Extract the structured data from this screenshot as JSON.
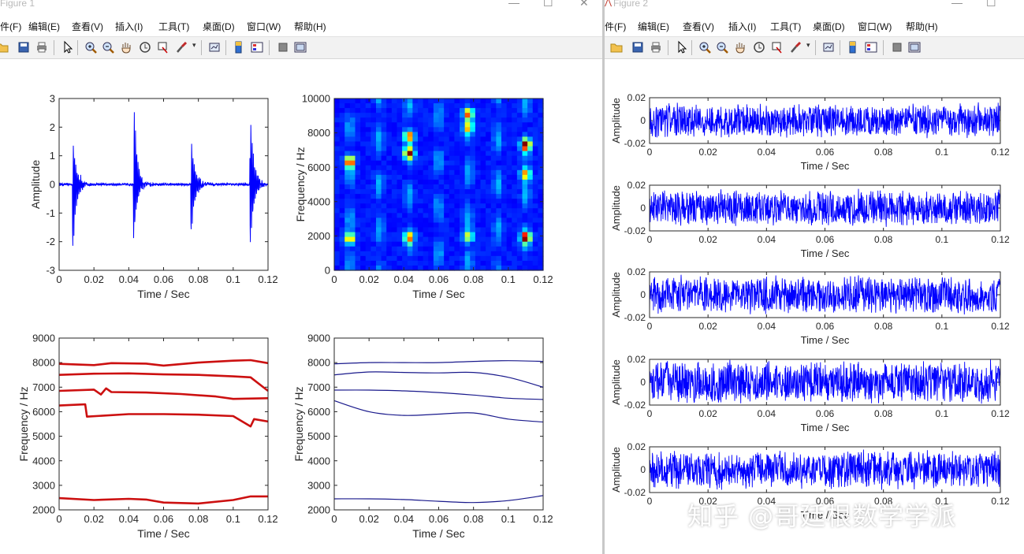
{
  "figure1": {
    "title": "Figure 1",
    "menu": [
      "件(F)",
      "编辑(E)",
      "查看(V)",
      "插入(I)",
      "工具(T)",
      "桌面(D)",
      "窗口(W)",
      "帮助(H)"
    ],
    "toolbar_icons": [
      "open-file-icon",
      "save-icon",
      "print-icon",
      "pointer-icon",
      "zoom-in-icon",
      "zoom-out-icon",
      "pan-hand-icon",
      "rotate-3d-icon",
      "data-cursor-icon",
      "brush-icon",
      "link-plot-icon",
      "colorbar-icon",
      "legend-icon",
      "hide-plot-tools-icon",
      "show-plot-tools-icon"
    ]
  },
  "figure2": {
    "title": "Figure 2",
    "menu": [
      "文件(F)",
      "编辑(E)",
      "查看(V)",
      "插入(I)",
      "工具(T)",
      "桌面(D)",
      "窗口(W)",
      "帮助(H)"
    ]
  },
  "colors": {
    "signal_blue": "#0000ff",
    "ridge_red": "#cc1010",
    "curve_navy": "#1a1a8c"
  },
  "chart_data": [
    {
      "type": "line",
      "xlabel": "Time / Sec",
      "ylabel": "Amplitude",
      "xlim": [
        0,
        0.12
      ],
      "ylim": [
        -3,
        3
      ],
      "xticks": [
        "0",
        "0.02",
        "0.04",
        "0.06",
        "0.08",
        "0.1",
        "0.12"
      ],
      "yticks": [
        "-3",
        "-2",
        "-1",
        "0",
        "1",
        "2",
        "3"
      ],
      "impulses": [
        {
          "t": 0.008,
          "peak": 1.65,
          "trough": -2.2
        },
        {
          "t": 0.043,
          "peak": 2.8,
          "trough": -1.85
        },
        {
          "t": 0.076,
          "peak": 1.65,
          "trough": -1.65
        },
        {
          "t": 0.11,
          "peak": 2.45,
          "trough": -2.05
        }
      ]
    },
    {
      "type": "heatmap",
      "xlabel": "Time / Sec",
      "ylabel": "Frequency / Hz",
      "xlim": [
        0,
        0.12
      ],
      "ylim": [
        0,
        10000
      ],
      "xticks": [
        "0",
        "0.02",
        "0.04",
        "0.06",
        "0.08",
        "0.1",
        "0.12"
      ],
      "yticks": [
        "0",
        "2000",
        "4000",
        "6000",
        "8000",
        "10000"
      ],
      "hotspots": [
        {
          "t": 0.009,
          "f": 6300,
          "level": 1.0
        },
        {
          "t": 0.009,
          "f": 1850,
          "level": 0.8
        },
        {
          "t": 0.043,
          "f": 7800,
          "level": 0.85
        },
        {
          "t": 0.043,
          "f": 6800,
          "level": 0.9
        },
        {
          "t": 0.043,
          "f": 1900,
          "level": 0.7
        },
        {
          "t": 0.077,
          "f": 9100,
          "level": 0.8
        },
        {
          "t": 0.077,
          "f": 8300,
          "level": 0.55
        },
        {
          "t": 0.077,
          "f": 1950,
          "level": 0.6
        },
        {
          "t": 0.11,
          "f": 7300,
          "level": 1.0
        },
        {
          "t": 0.11,
          "f": 5600,
          "level": 0.85
        },
        {
          "t": 0.11,
          "f": 1900,
          "level": 1.0
        }
      ]
    },
    {
      "type": "line",
      "xlabel": "Time / Sec",
      "ylabel": "Frequency / Hz",
      "xlim": [
        0,
        0.12
      ],
      "ylim": [
        2000,
        9000
      ],
      "xticks": [
        "0",
        "0.02",
        "0.04",
        "0.06",
        "0.08",
        "0.1",
        "0.12"
      ],
      "yticks": [
        "2000",
        "3000",
        "4000",
        "5000",
        "6000",
        "7000",
        "8000",
        "9000"
      ],
      "series": [
        {
          "x": [
            0,
            0.02,
            0.03,
            0.05,
            0.06,
            0.08,
            0.1,
            0.11,
            0.12
          ],
          "y": [
            7950,
            7900,
            7980,
            7960,
            7880,
            8000,
            8080,
            8100,
            7980
          ]
        },
        {
          "x": [
            0,
            0.02,
            0.04,
            0.06,
            0.08,
            0.1,
            0.11,
            0.12
          ],
          "y": [
            7500,
            7550,
            7560,
            7520,
            7500,
            7440,
            7400,
            6850
          ]
        },
        {
          "x": [
            0,
            0.02,
            0.024,
            0.027,
            0.03,
            0.05,
            0.07,
            0.09,
            0.1,
            0.12
          ],
          "y": [
            6850,
            6900,
            6700,
            6950,
            6800,
            6780,
            6720,
            6620,
            6520,
            6550
          ]
        },
        {
          "x": [
            0,
            0.015,
            0.016,
            0.04,
            0.06,
            0.08,
            0.1,
            0.11,
            0.112,
            0.12
          ],
          "y": [
            6250,
            6300,
            5800,
            5900,
            5900,
            5880,
            5820,
            5400,
            5700,
            5600
          ]
        },
        {
          "x": [
            0,
            0.02,
            0.04,
            0.05,
            0.06,
            0.08,
            0.1,
            0.11,
            0.12
          ],
          "y": [
            2480,
            2400,
            2450,
            2420,
            2300,
            2260,
            2400,
            2550,
            2550
          ]
        }
      ]
    },
    {
      "type": "line",
      "xlabel": "Time / Sec",
      "ylabel": "Frequency / Hz",
      "xlim": [
        0,
        0.12
      ],
      "ylim": [
        2000,
        9000
      ],
      "xticks": [
        "0",
        "0.02",
        "0.04",
        "0.06",
        "0.08",
        "0.1",
        "0.12"
      ],
      "yticks": [
        "2000",
        "3000",
        "4000",
        "5000",
        "6000",
        "7000",
        "8000",
        "9000"
      ],
      "series": [
        {
          "x": [
            0,
            0.02,
            0.04,
            0.06,
            0.08,
            0.1,
            0.12
          ],
          "y": [
            7950,
            8000,
            8000,
            8000,
            8050,
            8080,
            8050
          ]
        },
        {
          "x": [
            0,
            0.02,
            0.04,
            0.06,
            0.08,
            0.1,
            0.12
          ],
          "y": [
            7500,
            7620,
            7600,
            7580,
            7600,
            7400,
            7000
          ]
        },
        {
          "x": [
            0,
            0.02,
            0.04,
            0.06,
            0.08,
            0.1,
            0.12
          ],
          "y": [
            6880,
            6880,
            6850,
            6780,
            6680,
            6550,
            6500
          ]
        },
        {
          "x": [
            0,
            0.02,
            0.04,
            0.06,
            0.08,
            0.1,
            0.12
          ],
          "y": [
            6450,
            6000,
            5850,
            5900,
            5950,
            5700,
            5580
          ]
        },
        {
          "x": [
            0,
            0.02,
            0.04,
            0.06,
            0.08,
            0.1,
            0.12
          ],
          "y": [
            2450,
            2450,
            2420,
            2350,
            2300,
            2380,
            2580
          ]
        }
      ]
    },
    {
      "type": "line",
      "xlabel": "Time / Sec",
      "ylabel": "Amplitude",
      "xlim": [
        0,
        0.12
      ],
      "ylim": [
        -0.02,
        0.02
      ],
      "xticks": [
        "0",
        "0.02",
        "0.04",
        "0.06",
        "0.08",
        "0.1",
        "0.12"
      ],
      "yticks": [
        "0.02",
        "0",
        "-0.02"
      ],
      "noise_amplitude": 0.016
    },
    {
      "type": "line",
      "xlabel": "Time / Sec",
      "ylabel": "Amplitude",
      "xlim": [
        0,
        0.12
      ],
      "ylim": [
        -0.02,
        0.02
      ],
      "xticks": [
        "0",
        "0.02",
        "0.04",
        "0.06",
        "0.08",
        "0.1",
        "0.12"
      ],
      "yticks": [
        "0.02",
        "0",
        "-0.02"
      ],
      "noise_amplitude": 0.017
    },
    {
      "type": "line",
      "xlabel": "Time / Sec",
      "ylabel": "Amplitude",
      "xlim": [
        0,
        0.12
      ],
      "ylim": [
        -0.02,
        0.02
      ],
      "xticks": [
        "0",
        "0.02",
        "0.04",
        "0.06",
        "0.08",
        "0.1",
        "0.12"
      ],
      "yticks": [
        "0.02",
        "0",
        "-0.02"
      ],
      "noise_amplitude": 0.018
    },
    {
      "type": "line",
      "xlabel": "Time / Sec",
      "ylabel": "Amplitude",
      "xlim": [
        0,
        0.12
      ],
      "ylim": [
        -0.02,
        0.02
      ],
      "xticks": [
        "0",
        "0.02",
        "0.04",
        "0.06",
        "0.08",
        "0.1",
        "0.12"
      ],
      "yticks": [
        "0.02",
        "0",
        "-0.02"
      ],
      "noise_amplitude": 0.02
    },
    {
      "type": "line",
      "xlabel": "Time / Sec",
      "ylabel": "Amplitude",
      "xlim": [
        0,
        0.12
      ],
      "ylim": [
        -0.02,
        0.02
      ],
      "xticks": [
        "0",
        "0.02",
        "0.04",
        "0.06",
        "0.08",
        "0.1",
        "0.12"
      ],
      "yticks": [
        "0.02",
        "0",
        "-0.02"
      ],
      "noise_amplitude": 0.018
    }
  ],
  "watermark": "知乎 @哥廷根数学学派"
}
